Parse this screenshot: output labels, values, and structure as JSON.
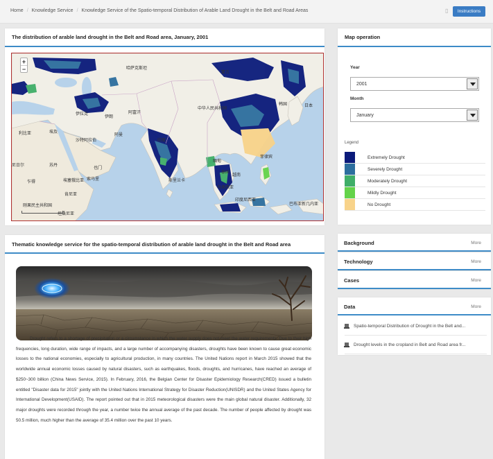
{
  "breadcrumb": {
    "items": [
      "Home",
      "Knowledge Service",
      "Knowledge Service of the Spatio-temporal Distribution of Arable Land Drought in the Belt and Road Areas"
    ],
    "instructions_label": "Instructions"
  },
  "map_panel": {
    "title": "The distribution of arable land drought in the Belt and Road area, January, 2001",
    "zoom_in": "+",
    "zoom_out": "−",
    "labels": [
      {
        "text": "哈萨克斯坦"
      },
      {
        "text": "蒙古"
      },
      {
        "text": "中华人民共和国"
      },
      {
        "text": "韩国"
      },
      {
        "text": "日本"
      },
      {
        "text": "伊拉克"
      },
      {
        "text": "伊朗"
      },
      {
        "text": "阿富汗"
      },
      {
        "text": "沙特阿拉伯"
      },
      {
        "text": "阿曼"
      },
      {
        "text": "印度"
      },
      {
        "text": "缅甸"
      },
      {
        "text": "泰国"
      },
      {
        "text": "越南"
      },
      {
        "text": "菲律宾"
      },
      {
        "text": "马来西亚"
      },
      {
        "text": "印度尼西亚"
      },
      {
        "text": "苏丹"
      },
      {
        "text": "埃塞俄比亚"
      },
      {
        "text": "索马里"
      },
      {
        "text": "肯尼亚"
      },
      {
        "text": "乍得"
      },
      {
        "text": "尼日尔"
      },
      {
        "text": "也门"
      },
      {
        "text": "斯里兰卡"
      },
      {
        "text": "利比亚"
      },
      {
        "text": "埃及"
      },
      {
        "text": "刚果民主共和国"
      },
      {
        "text": "坦桑尼亚"
      },
      {
        "text": "巴布亚新几内亚"
      }
    ]
  },
  "map_operation": {
    "title": "Map operation",
    "year_label": "Year",
    "year_value": "2001",
    "month_label": "Month",
    "month_value": "January",
    "legend_title": "Legend",
    "legend": [
      {
        "label": "Extremely Drought",
        "color": "#0a1a7a"
      },
      {
        "label": "Severely Drought",
        "color": "#2c6e9e"
      },
      {
        "label": "Moderately Drought",
        "color": "#3fae68"
      },
      {
        "label": "Mildly Drought",
        "color": "#64d34a"
      },
      {
        "label": "No Drought",
        "color": "#f8d38a"
      }
    ]
  },
  "sidebar_sections": [
    {
      "title": "Background",
      "more": "More"
    },
    {
      "title": "Technology",
      "more": "More"
    },
    {
      "title": "Cases",
      "more": "More"
    }
  ],
  "data_panel": {
    "title": "Data",
    "more": "More",
    "items": [
      "Spatio-temporal Distribution of Drought in the Belt and...",
      "Drought levels in the cropland in Belt and Road area fr..."
    ]
  },
  "article_panel": {
    "title": "Thematic knowledge service for the spatio-temporal distribution of arable land drought in the Belt and Road area",
    "body": "Drought refers to a shortage of precipitation or a circumstance in which the water supply does not meet the water requirements. Due to their high frequencies, long duration, wide range of impacts, and a large number of accompanying disasters, droughts have been known to cause great economic losses to the national economies, especially to agricultural production, in many countries. The United Nations report in March 2015 showed that the worldwide annual economic losses caused by natural disasters, such as earthquakes, floods, droughts, and hurricanes, have reached an average of $250~300 billion (China News Service, 2015). In February, 2016, the Belgian Center for Disaster Epidemiology Research(CRED) issued a bulletin entitled \"Disaster data for 2015\" jointly with the United Nations International Strategy for Disaster Reduction(UNISDR) and the United States Agency for International Development(USAID). The report pointed out that in 2015 meteorological disasters were the main global natural disaster. Additionally, 32 major droughts were recorded through the year, a number twice the annual average of the past decade. The number of people affected by drought was 50.5 million, much higher than the average of 35.4 million over the past 10 years."
  }
}
